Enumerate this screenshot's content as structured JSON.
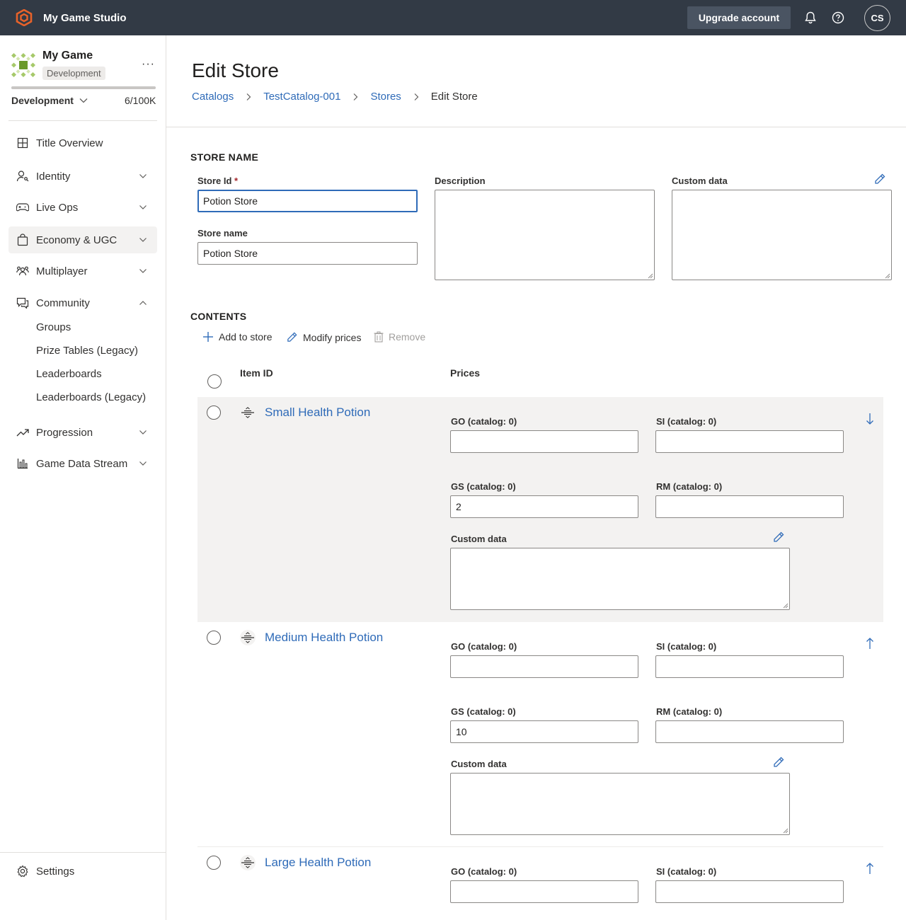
{
  "topbar": {
    "app_title": "My Game Studio",
    "upgrade_label": "Upgrade account",
    "avatar_initials": "CS"
  },
  "sidebar": {
    "game_name": "My Game",
    "env_badge": "Development",
    "usage_fraction": 1.0,
    "env_select": "Development",
    "env_count": "6/100K",
    "nav": {
      "title_overview": "Title Overview",
      "identity": "Identity",
      "live_ops": "Live Ops",
      "economy": "Economy & UGC",
      "multiplayer": "Multiplayer",
      "community": "Community",
      "community_items": [
        "Groups",
        "Prize Tables (Legacy)",
        "Leaderboards",
        "Leaderboards (Legacy)"
      ],
      "progression": "Progression",
      "game_data_stream": "Game Data Stream"
    },
    "settings": "Settings"
  },
  "main": {
    "title": "Edit Store",
    "breadcrumb": [
      "Catalogs",
      "TestCatalog-001",
      "Stores",
      "Edit Store"
    ],
    "store_section": "STORE NAME",
    "store_id_label": "Store Id",
    "store_id_required": "*",
    "store_id_value": "Potion Store",
    "store_name_label": "Store name",
    "store_name_value": "Potion Store",
    "description_label": "Description",
    "custom_data_label": "Custom data",
    "contents_section": "CONTENTS",
    "commands": {
      "add": "Add to store",
      "modify": "Modify prices",
      "remove": "Remove"
    },
    "columns": {
      "item_id": "Item ID",
      "prices": "Prices"
    },
    "items": [
      {
        "name": "Small Health Potion",
        "go_label": "GO (catalog: 0)",
        "go_value": "",
        "si_label": "SI (catalog: 0)",
        "si_value": "",
        "gs_label": "GS (catalog: 0)",
        "gs_value": "2",
        "rm_label": "RM (catalog: 0)",
        "rm_value": "",
        "custom_label": "Custom data"
      },
      {
        "name": "Medium Health Potion",
        "go_label": "GO (catalog: 0)",
        "go_value": "",
        "si_label": "SI (catalog: 0)",
        "si_value": "",
        "gs_label": "GS (catalog: 0)",
        "gs_value": "10",
        "rm_label": "RM (catalog: 0)",
        "rm_value": "",
        "custom_label": "Custom data"
      },
      {
        "name": "Large Health Potion",
        "go_label": "GO (catalog: 0)",
        "go_value": "",
        "si_label": "SI (catalog: 0)",
        "si_value": ""
      }
    ]
  },
  "colors": {
    "topbar": "#323a45",
    "accent_link": "#2f6bb8",
    "brand_orange": "#e8622a",
    "selected_row": "#f3f2f1"
  }
}
